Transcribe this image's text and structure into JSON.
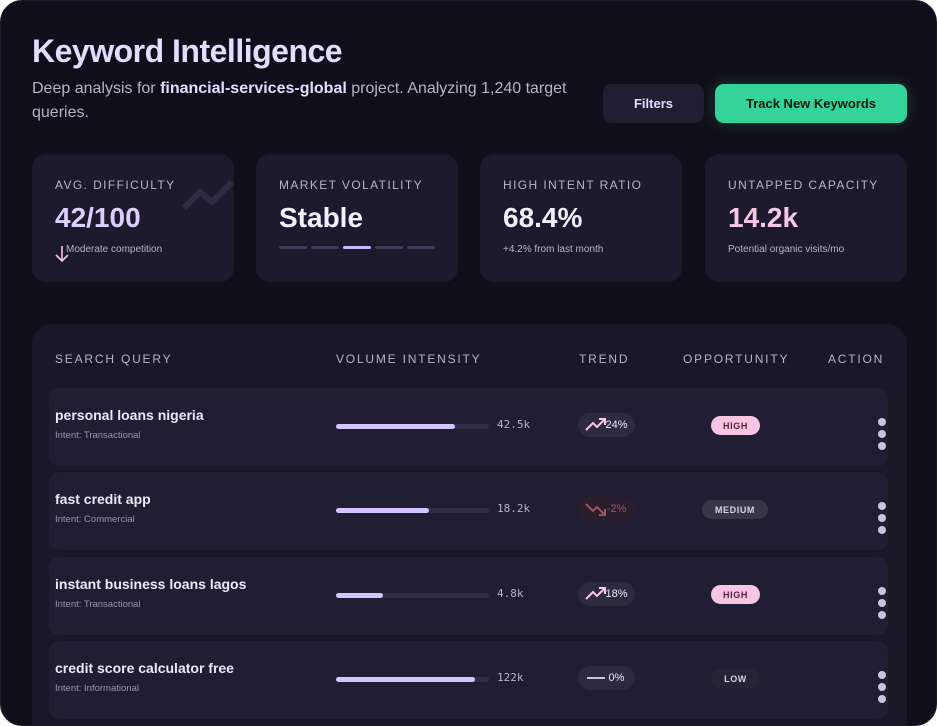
{
  "header": {
    "title": "Keyword Intelligence",
    "subtitle_prefix": "Deep analysis for ",
    "project": "financial-services-global",
    "subtitle_suffix": " project. Analyzing 1,240 target queries."
  },
  "actions": {
    "filters_label": "Filters",
    "track_label": "Track New Keywords"
  },
  "colors": {
    "accent_green": "#34d399",
    "accent_lavender": "#d4c4ff",
    "accent_pink": "#f9c6e1",
    "trend_down": "#a3506c"
  },
  "stats": [
    {
      "label": "AVG. DIFFICULTY",
      "value": "42/100",
      "note": "Moderate competition",
      "icon": "arrow-down-icon",
      "color": "#dccfff"
    },
    {
      "label": "MARKET VOLATILITY",
      "value": "Stable",
      "segments_total": 5,
      "segment_active": 3,
      "color": "#f3efff"
    },
    {
      "label": "HIGH INTENT RATIO",
      "value": "68.4%",
      "note": "+4.2% from last month",
      "color": "#f3efff"
    },
    {
      "label": "UNTAPPED CAPACITY",
      "value": "14.2k",
      "note": "Potential organic visits/mo",
      "color": "#f7c8e4"
    }
  ],
  "table": {
    "columns": [
      "SEARCH QUERY",
      "VOLUME INTENSITY",
      "TREND",
      "OPPORTUNITY",
      "ACTION"
    ],
    "rows": [
      {
        "query": "personal loans nigeria",
        "intent": "Intent: Transactional",
        "volume": "42.5k",
        "volume_level": 0.78,
        "trend": "24%",
        "trend_dir": "up",
        "opportunity": "HIGH"
      },
      {
        "query": "fast credit app",
        "intent": "Intent: Commercial",
        "volume": "18.2k",
        "volume_level": 0.61,
        "trend": "-2%",
        "trend_dir": "down",
        "opportunity": "MEDIUM"
      },
      {
        "query": "instant business loans lagos",
        "intent": "Intent: Transactional",
        "volume": "4.8k",
        "volume_level": 0.31,
        "trend": "18%",
        "trend_dir": "up",
        "opportunity": "HIGH"
      },
      {
        "query": "credit score calculator free",
        "intent": "Intent: Informational",
        "volume": "122k",
        "volume_level": 0.91,
        "trend": "0%",
        "trend_dir": "flat",
        "opportunity": "LOW"
      }
    ]
  }
}
